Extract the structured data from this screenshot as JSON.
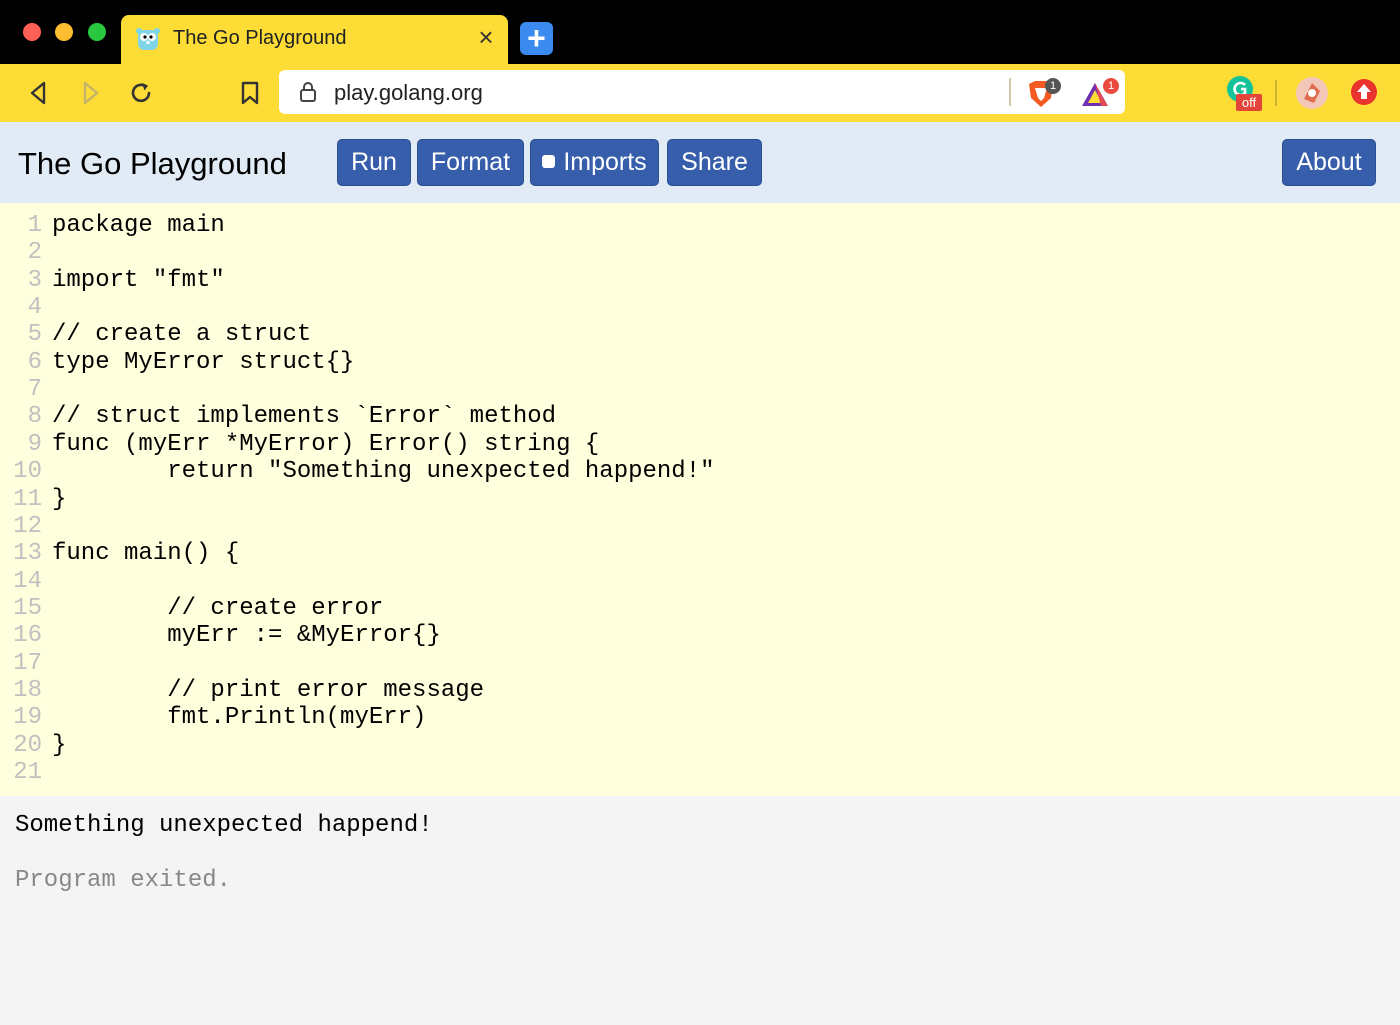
{
  "browser": {
    "tab_title": "The Go Playground",
    "tab_close": "×",
    "new_tab": "+",
    "url": "play.golang.org",
    "brave_badge": "1",
    "rewards_badge": "1",
    "grammarly_state": "off"
  },
  "header": {
    "title": "The Go Playground",
    "run_label": "Run",
    "format_label": "Format",
    "imports_label": "Imports",
    "share_label": "Share",
    "about_label": "About"
  },
  "editor": {
    "lines": [
      {
        "n": "1",
        "code": "package main"
      },
      {
        "n": "2",
        "code": ""
      },
      {
        "n": "3",
        "code": "import \"fmt\""
      },
      {
        "n": "4",
        "code": ""
      },
      {
        "n": "5",
        "code": "// create a struct"
      },
      {
        "n": "6",
        "code": "type MyError struct{}"
      },
      {
        "n": "7",
        "code": ""
      },
      {
        "n": "8",
        "code": "// struct implements `Error` method"
      },
      {
        "n": "9",
        "code": "func (myErr *MyError) Error() string {"
      },
      {
        "n": "10",
        "code": "        return \"Something unexpected happend!\""
      },
      {
        "n": "11",
        "code": "}"
      },
      {
        "n": "12",
        "code": ""
      },
      {
        "n": "13",
        "code": "func main() {"
      },
      {
        "n": "14",
        "code": ""
      },
      {
        "n": "15",
        "code": "        // create error"
      },
      {
        "n": "16",
        "code": "        myErr := &MyError{}"
      },
      {
        "n": "17",
        "code": ""
      },
      {
        "n": "18",
        "code": "        // print error message"
      },
      {
        "n": "19",
        "code": "        fmt.Println(myErr)"
      },
      {
        "n": "20",
        "code": "}"
      },
      {
        "n": "21",
        "code": ""
      }
    ]
  },
  "output": {
    "stdout": "Something unexpected happend!",
    "system": "Program exited."
  },
  "colors": {
    "chrome_yellow": "#fddc35",
    "header_bg": "#e0ebf5",
    "button_blue": "#375eab",
    "editor_bg": "#ffffdd",
    "output_bg": "#f4f4f4"
  }
}
